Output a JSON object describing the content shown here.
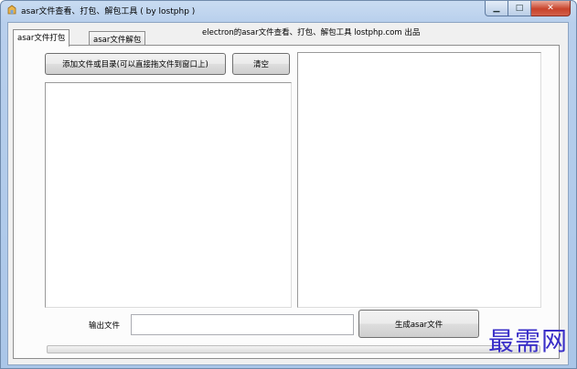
{
  "window": {
    "title": "asar文件查看、打包、解包工具 ( by lostphp )",
    "controls": {
      "minimize": "▁",
      "maximize": "□",
      "close": "✕"
    }
  },
  "tabs": [
    {
      "label": "asar文件打包",
      "active": true
    },
    {
      "label": "asar文件解包",
      "active": false
    }
  ],
  "header_note": "electron的asar文件查看、打包、解包工具 lostphp.com 出品",
  "pack_tab": {
    "add_button": "添加文件或目录(可以直接拖文件到窗口上)",
    "clear_button": "清空",
    "output_label": "输出文件",
    "output_value": "",
    "generate_button": "生成asar文件",
    "progress": 0
  },
  "watermark": "最需网"
}
